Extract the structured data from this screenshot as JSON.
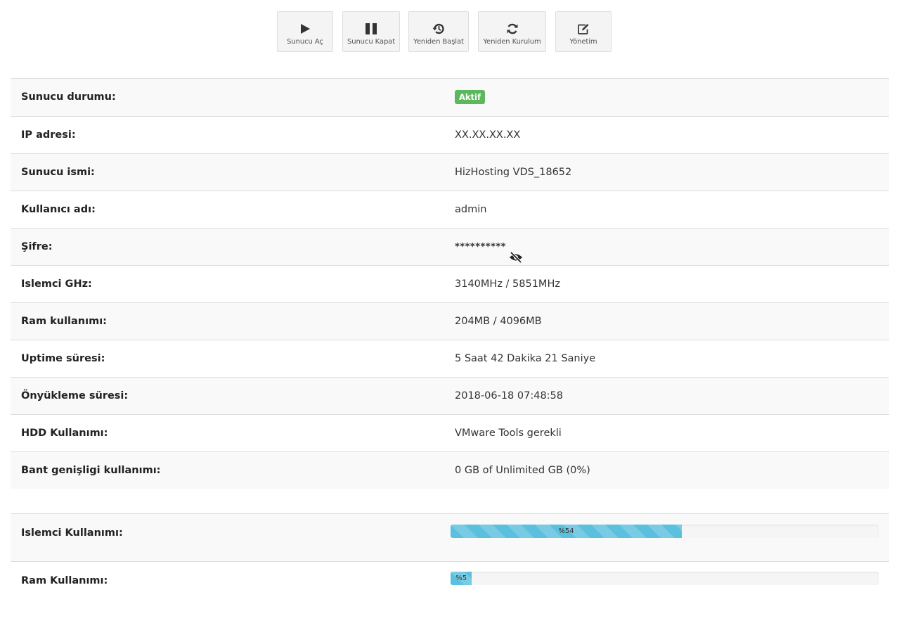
{
  "toolbar": {
    "buttons": [
      {
        "label": "Sunucu Aç",
        "icon": "play-icon"
      },
      {
        "label": "Sunucu Kapat",
        "icon": "pause-icon"
      },
      {
        "label": "Yeniden Başlat",
        "icon": "history-icon"
      },
      {
        "label": "Yeniden Kurulum",
        "icon": "refresh-icon"
      },
      {
        "label": "Yönetim",
        "icon": "edit-icon"
      }
    ]
  },
  "info": {
    "status_label": "Sunucu durumu:",
    "status_badge": "Aktif",
    "ip_label": "IP adresi:",
    "ip_value": "XX.XX.XX.XX",
    "hostname_label": "Sunucu ismi:",
    "hostname_value": "HizHosting VDS_18652",
    "username_label": "Kullanıcı adı:",
    "username_value": "admin",
    "password_label": "Şifre:",
    "password_value": "**********",
    "cpu_label": "Islemci GHz:",
    "cpu_value": "3140MHz / 5851MHz",
    "ram_label": "Ram kullanımı:",
    "ram_value": "204MB / 4096MB",
    "uptime_label": "Uptime süresi:",
    "uptime_value": "5 Saat 42 Dakika 21 Saniye",
    "boot_label": "Önyükleme süresi:",
    "boot_value": "2018-06-18 07:48:58",
    "hdd_label": "HDD Kullanımı:",
    "hdd_value": "VMware Tools gerekli",
    "bandwidth_label": "Bant genişligi kullanımı:",
    "bandwidth_value": "0 GB of Unlimited GB (0%)"
  },
  "usage": {
    "cpu_label": "Islemci Kullanımı:",
    "cpu_percent": 54,
    "cpu_text": "%54",
    "ram_label": "Ram Kullanımı:",
    "ram_percent": 5,
    "ram_text": "%5"
  },
  "colors": {
    "badge": "#5cb85c",
    "progress": "#5bc0de"
  }
}
